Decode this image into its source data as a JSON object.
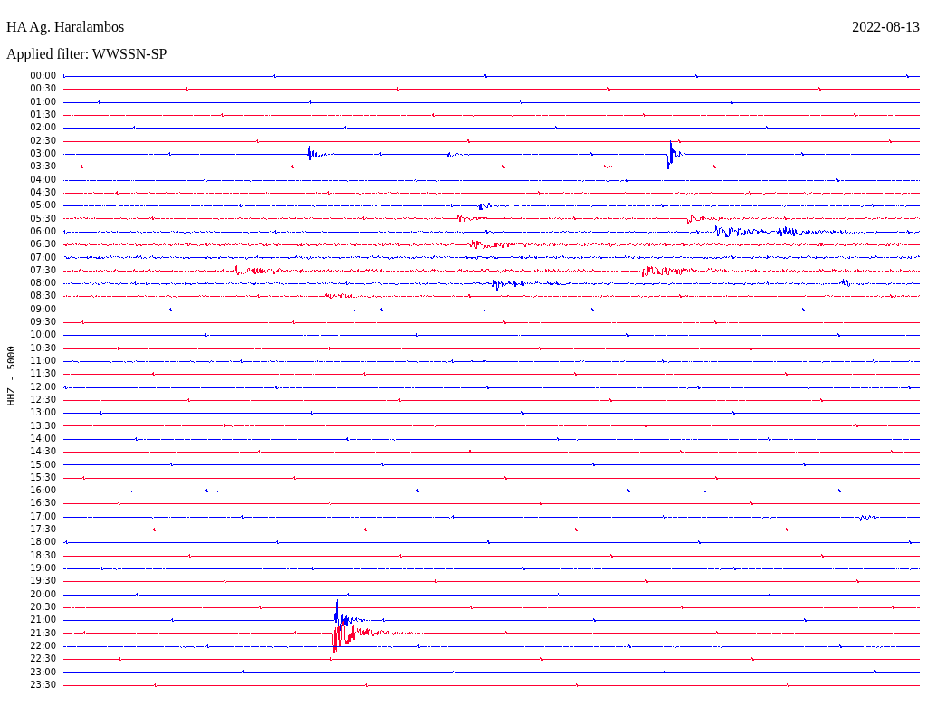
{
  "header": {
    "station": "HA Ag. Haralambos",
    "date": "2022-08-13",
    "filter": "Applied filter: WWSSN-SP"
  },
  "axis_label": "HHZ - 5000",
  "traces": [
    {
      "time": "00:00",
      "color": "#0000ff"
    },
    {
      "time": "00:30",
      "color": "#ff0033"
    },
    {
      "time": "01:00",
      "color": "#0000ff"
    },
    {
      "time": "01:30",
      "color": "#ff0033"
    },
    {
      "time": "02:00",
      "color": "#0000ff"
    },
    {
      "time": "02:30",
      "color": "#ff0033"
    },
    {
      "time": "03:00",
      "color": "#0000ff"
    },
    {
      "time": "03:30",
      "color": "#ff0033"
    },
    {
      "time": "04:00",
      "color": "#0000ff"
    },
    {
      "time": "04:30",
      "color": "#ff0033"
    },
    {
      "time": "05:00",
      "color": "#0000ff"
    },
    {
      "time": "05:30",
      "color": "#ff0033"
    },
    {
      "time": "06:00",
      "color": "#0000ff"
    },
    {
      "time": "06:30",
      "color": "#ff0033"
    },
    {
      "time": "07:00",
      "color": "#0000ff"
    },
    {
      "time": "07:30",
      "color": "#ff0033"
    },
    {
      "time": "08:00",
      "color": "#0000ff"
    },
    {
      "time": "08:30",
      "color": "#ff0033"
    },
    {
      "time": "09:00",
      "color": "#0000ff"
    },
    {
      "time": "09:30",
      "color": "#ff0033"
    },
    {
      "time": "10:00",
      "color": "#0000ff"
    },
    {
      "time": "10:30",
      "color": "#ff0033"
    },
    {
      "time": "11:00",
      "color": "#0000ff"
    },
    {
      "time": "11:30",
      "color": "#ff0033"
    },
    {
      "time": "12:00",
      "color": "#0000ff"
    },
    {
      "time": "12:30",
      "color": "#ff0033"
    },
    {
      "time": "13:00",
      "color": "#0000ff"
    },
    {
      "time": "13:30",
      "color": "#ff0033"
    },
    {
      "time": "14:00",
      "color": "#0000ff"
    },
    {
      "time": "14:30",
      "color": "#ff0033"
    },
    {
      "time": "15:00",
      "color": "#0000ff"
    },
    {
      "time": "15:30",
      "color": "#ff0033"
    },
    {
      "time": "16:00",
      "color": "#0000ff"
    },
    {
      "time": "16:30",
      "color": "#ff0033"
    },
    {
      "time": "17:00",
      "color": "#0000ff"
    },
    {
      "time": "17:30",
      "color": "#ff0033"
    },
    {
      "time": "18:00",
      "color": "#0000ff"
    },
    {
      "time": "18:30",
      "color": "#ff0033"
    },
    {
      "time": "19:00",
      "color": "#0000ff"
    },
    {
      "time": "19:30",
      "color": "#ff0033"
    },
    {
      "time": "20:00",
      "color": "#0000ff"
    },
    {
      "time": "20:30",
      "color": "#ff0033"
    },
    {
      "time": "21:00",
      "color": "#0000ff"
    },
    {
      "time": "21:30",
      "color": "#ff0033"
    },
    {
      "time": "22:00",
      "color": "#0000ff"
    },
    {
      "time": "22:30",
      "color": "#ff0033"
    },
    {
      "time": "23:00",
      "color": "#0000ff"
    },
    {
      "time": "23:30",
      "color": "#ff0033"
    }
  ]
}
